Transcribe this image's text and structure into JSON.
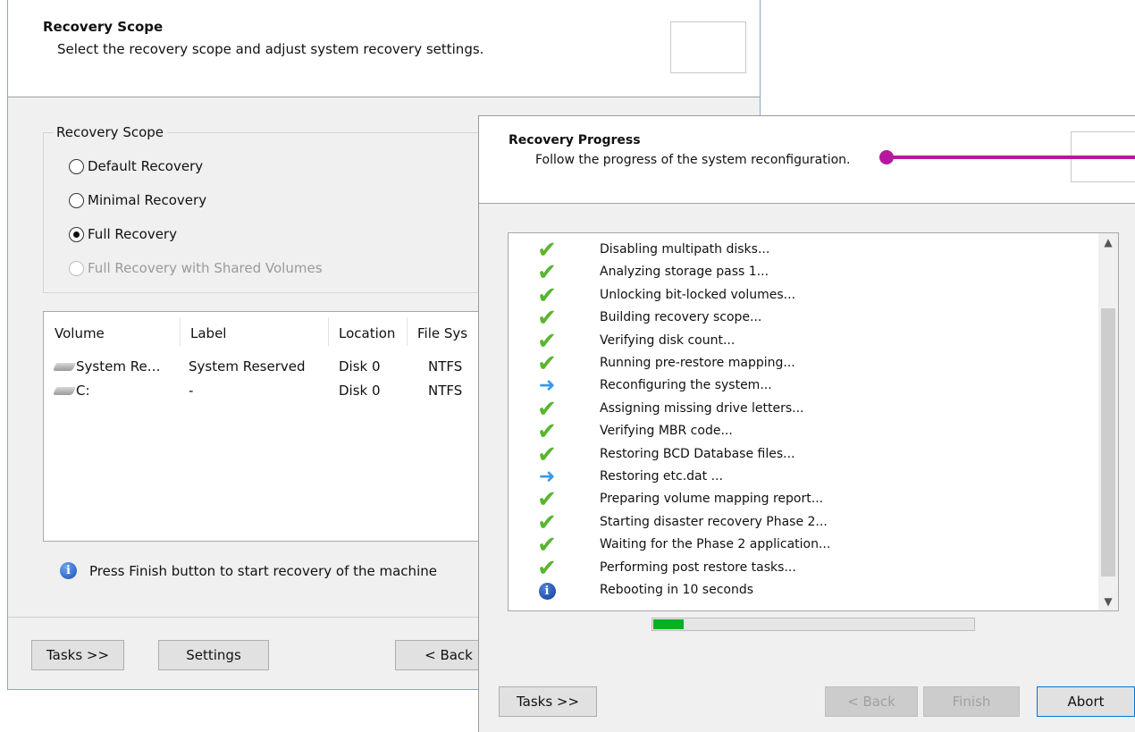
{
  "scope_window": {
    "title": "Recovery Scope",
    "subtitle": "Select the recovery scope and adjust system recovery settings.",
    "group_label": "Recovery Scope",
    "options": [
      {
        "label": "Default Recovery",
        "selected": false,
        "enabled": true
      },
      {
        "label": "Minimal Recovery",
        "selected": false,
        "enabled": true
      },
      {
        "label": "Full Recovery",
        "selected": true,
        "enabled": true
      },
      {
        "label": "Full Recovery with Shared Volumes",
        "selected": false,
        "enabled": false
      }
    ],
    "table": {
      "columns": [
        "Volume",
        "Label",
        "Location",
        "File Sys"
      ],
      "rows": [
        {
          "volume": "System Re…",
          "label": "System Reserved",
          "location": "Disk 0",
          "fs": "NTFS"
        },
        {
          "volume": "C:",
          "label": "-",
          "location": "Disk 0",
          "fs": "NTFS"
        }
      ]
    },
    "info_text": "Press Finish button to start recovery of the machine",
    "buttons": {
      "tasks": "Tasks >>",
      "settings": "Settings",
      "back": "< Back"
    }
  },
  "progress_window": {
    "title": "Recovery Progress",
    "subtitle": "Follow the progress of the system reconfiguration.",
    "steps": [
      {
        "icon": "check-icon",
        "text": "Disabling multipath disks..."
      },
      {
        "icon": "check-icon",
        "text": "Analyzing storage pass 1..."
      },
      {
        "icon": "check-icon",
        "text": "Unlocking bit-locked volumes..."
      },
      {
        "icon": "check-icon",
        "text": "Building recovery scope..."
      },
      {
        "icon": "check-icon",
        "text": "Verifying disk count..."
      },
      {
        "icon": "check-icon",
        "text": "Running pre-restore mapping..."
      },
      {
        "icon": "arrow-icon",
        "text": "Reconfiguring the system..."
      },
      {
        "icon": "check-icon",
        "text": "Assigning missing drive letters..."
      },
      {
        "icon": "check-icon",
        "text": "Verifying MBR code..."
      },
      {
        "icon": "check-icon",
        "text": "Restoring BCD Database files..."
      },
      {
        "icon": "arrow-icon",
        "text": "Restoring etc.dat ..."
      },
      {
        "icon": "check-icon",
        "text": "Preparing volume mapping report..."
      },
      {
        "icon": "check-icon",
        "text": "Starting disaster recovery Phase 2..."
      },
      {
        "icon": "check-icon",
        "text": "Waiting for the Phase 2 application..."
      },
      {
        "icon": "check-icon",
        "text": "Performing post restore tasks..."
      },
      {
        "icon": "info-icon",
        "text": "Rebooting in 10 seconds"
      }
    ],
    "progress_fraction": 0.1,
    "buttons": {
      "tasks": "Tasks >>",
      "back": "< Back",
      "finish": "Finish",
      "abort": "Abort"
    }
  },
  "colors": {
    "accent": "#0078d7",
    "progress": "#06b025",
    "check": "#5ab531",
    "callout": "#b5179e"
  }
}
